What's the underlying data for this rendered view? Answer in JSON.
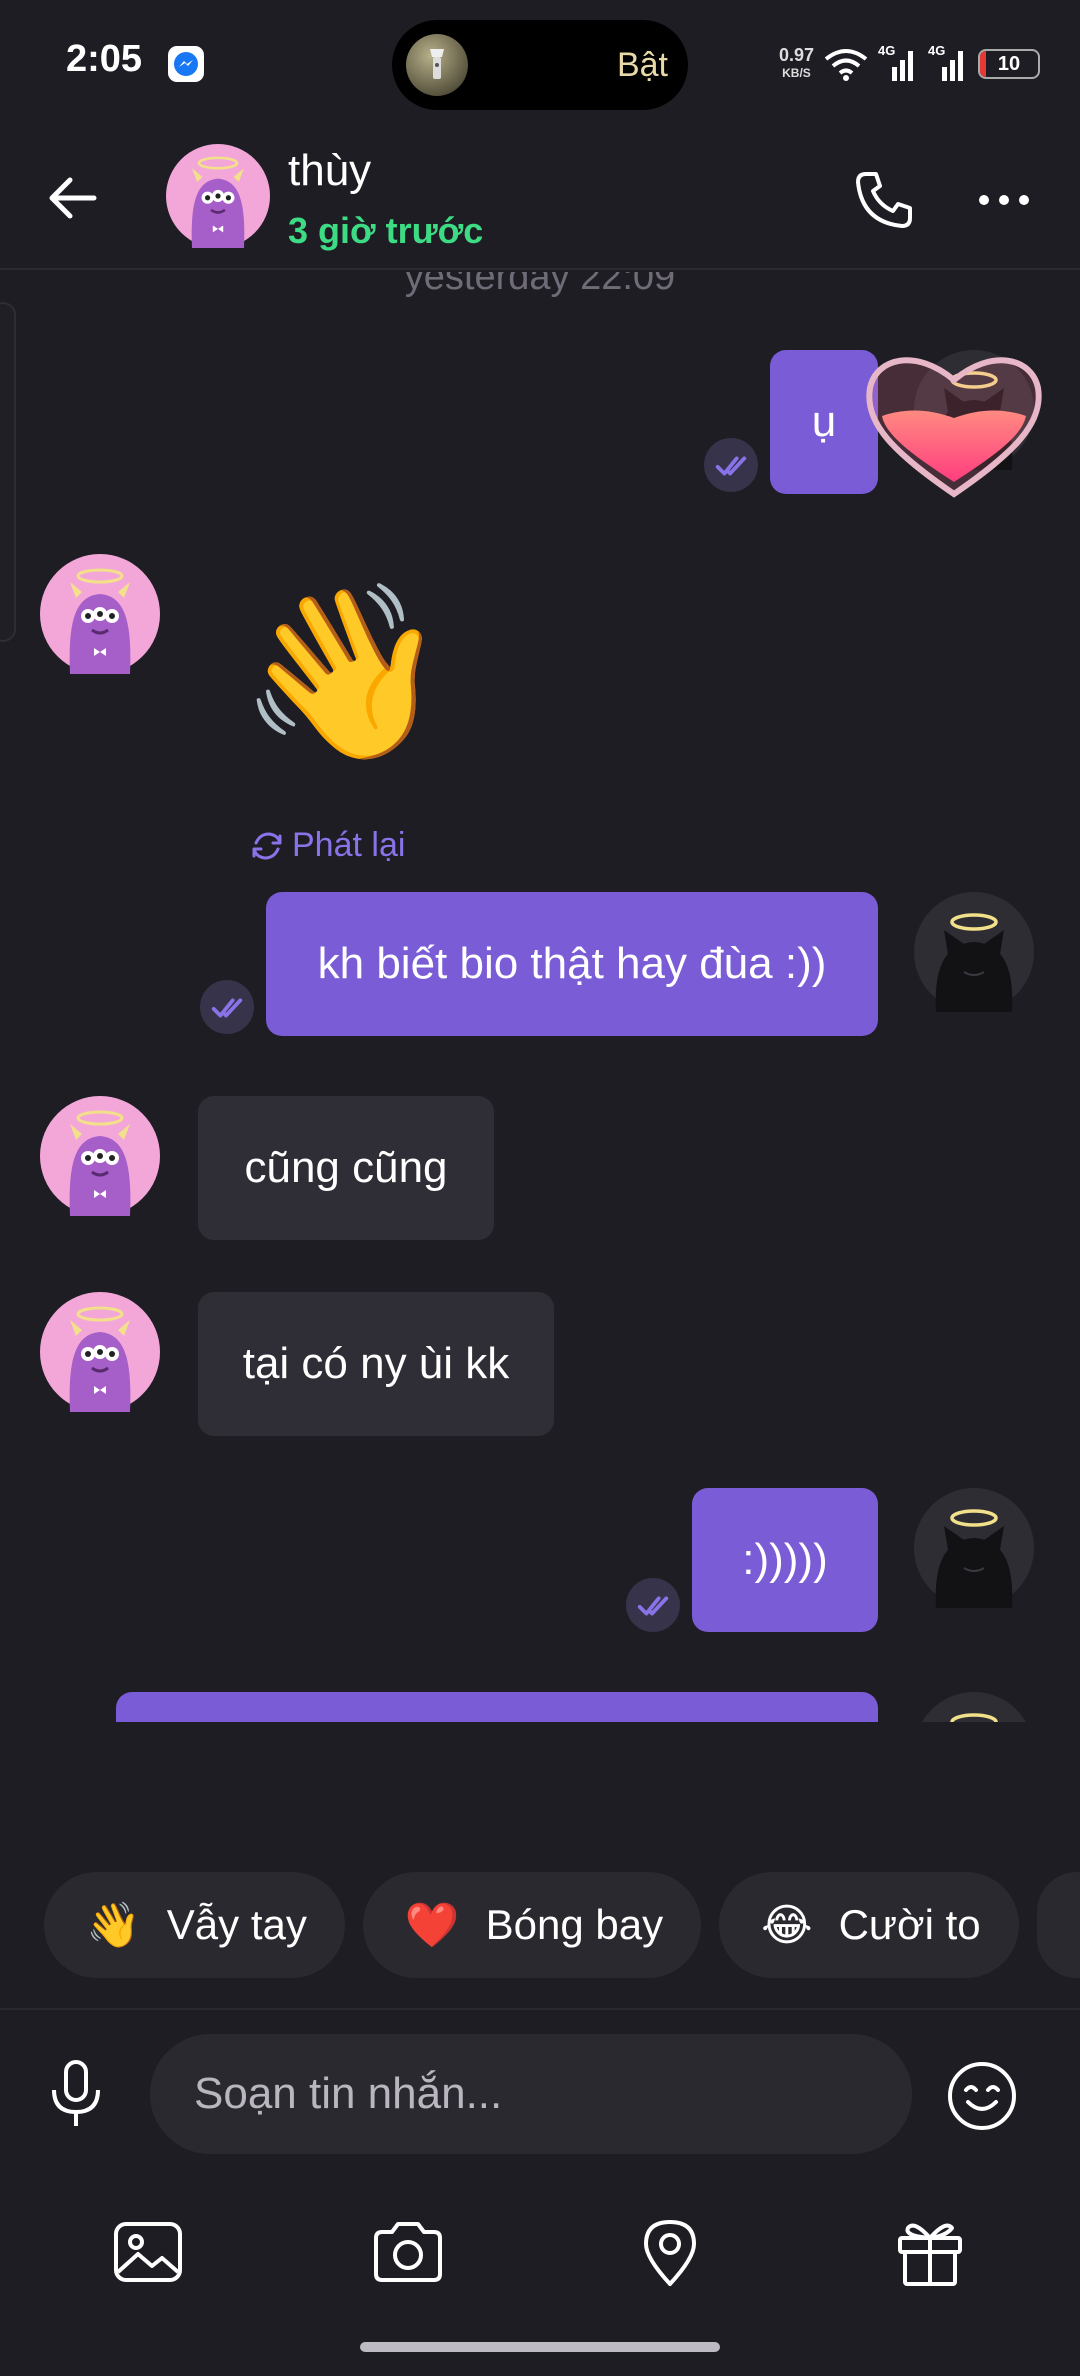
{
  "status_bar": {
    "time": "2:05",
    "island_text": "Bật",
    "speed_value": "0.97",
    "speed_unit": "KB/S",
    "network_1": "4G",
    "network_2": "4G",
    "battery": "10",
    "battery_level": 0.1
  },
  "header": {
    "name": "thùy",
    "status": "3 giờ trước",
    "status_color": "#3ddc84"
  },
  "chat": {
    "timestamp": "yesterday 22:09",
    "messages": [
      {
        "direction": "out",
        "text": "ụ",
        "reaction": "heart"
      },
      {
        "direction": "in",
        "type": "animated-emoji",
        "emoji": "👋",
        "replay_label": "Phát lại"
      },
      {
        "direction": "out",
        "text": "kh biết bio thật hay đùa :))"
      },
      {
        "direction": "in",
        "text": "cũng cũng"
      },
      {
        "direction": "in",
        "text": "tại có ny ùi kk"
      },
      {
        "direction": "out",
        "text": ":)))))"
      }
    ]
  },
  "quick_replies": [
    {
      "emoji": "👋",
      "label": "Vẫy tay"
    },
    {
      "emoji": "❤️",
      "label": "Bóng bay"
    },
    {
      "emoji": "😂",
      "label": "Cười to"
    }
  ],
  "composer": {
    "placeholder": "Soạn tin nhắn..."
  },
  "colors": {
    "background": "#1f1d24",
    "outgoing_bubble": "#7a5cd6",
    "incoming_bubble": "#2f2d35",
    "accent": "#8a73e8"
  },
  "icons": {
    "back": "arrow-left-icon",
    "call": "phone-icon",
    "more": "more-horizontal-icon",
    "mic": "microphone-icon",
    "emoji": "smiley-icon",
    "toolbar": [
      "image-icon",
      "camera-icon",
      "location-pin-icon",
      "gift-icon"
    ]
  }
}
